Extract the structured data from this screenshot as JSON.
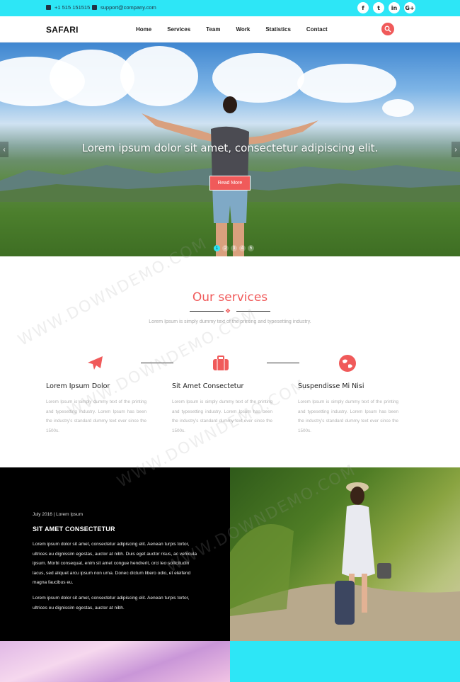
{
  "topbar": {
    "phone": "+1 515 151515",
    "email": "support@company.com",
    "social": [
      "f",
      "t",
      "in",
      "G+"
    ]
  },
  "nav": {
    "logo": "SAFARI",
    "items": [
      "Home",
      "Services",
      "Team",
      "Work",
      "Statistics",
      "Contact"
    ]
  },
  "hero": {
    "title": "Lorem ipsum dolor sit amet, consectetur adipiscing elit.",
    "button": "Read More",
    "dots": [
      "1",
      "2",
      "3",
      "4",
      "5"
    ],
    "active_dot": 1
  },
  "services": {
    "title": "Our services",
    "subtitle": "Lorem Ipsum is simply dummy text of the printing and typesetting industry.",
    "items": [
      {
        "icon": "airplane-icon",
        "heading": "Lorem Ipsum Dolor",
        "text": "Lorem Ipsum is simply dummy text of the printing and typesetting industry. Lorem Ipsum has been the industry's standard dummy text ever since the 1500s."
      },
      {
        "icon": "suitcase-icon",
        "heading": "Sit Amet Consectetur",
        "text": "Lorem Ipsum is simply dummy text of the printing and typesetting industry. Lorem Ipsum has been the industry's standard dummy text ever since the 1500s."
      },
      {
        "icon": "globe-icon",
        "heading": "Suspendisse Mi Nisi",
        "text": "Lorem Ipsum is simply dummy text of the printing and typesetting industry. Lorem Ipsum has been the industry's standard dummy text ever since the 1500s."
      }
    ]
  },
  "blog": {
    "date": "July 2016 | Lorem Ipsum",
    "heading": "SIT AMET CONSECTETUR",
    "p1": "Lorem ipsum dolor sit amet, consectetur adipiscing elit. Aenean turpis tortor, ultrices eu dignissim egestas, auctor at nibh. Duis eget auctor risus, ac vehicula ipsum. Morbi consequat, enim sit amet congue hendrerit, orci leo sollicitudin lacus, sed aliquet arcu ipsum non urna. Donec dictum libero odio, et eleifend magna faucibus eu.",
    "p2": "Lorem ipsum dolor sit amet, consectetur adipiscing elit. Aenean turpis tortor, ultrices eu dignissim egestas, auctor at nibh."
  },
  "watermark": "WWW.DOWNDEMO.COM",
  "colors": {
    "accent": "#f05a5a",
    "cyan": "#2de6f6",
    "dark": "#000000"
  }
}
